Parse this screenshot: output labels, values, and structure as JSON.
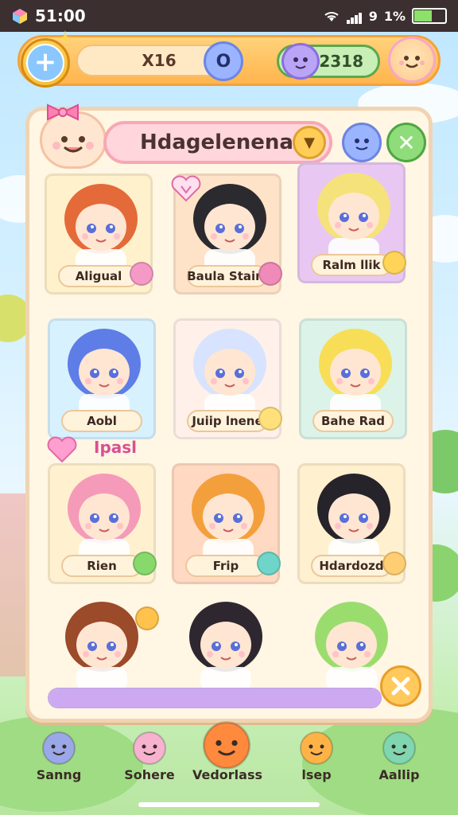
{
  "status_bar": {
    "time": "51:00",
    "signal_text": "9",
    "battery_percent_label": "1%",
    "battery_level": 0.55
  },
  "top_bar": {
    "coin_value": "X16",
    "o_button": "O",
    "gem_value": "2318"
  },
  "panel": {
    "title": "Hdagelenena",
    "favorites_label": "Ipasl"
  },
  "characters": [
    {
      "name": "Aligual",
      "hair": "#e46a3a",
      "bg": "#fff1cc",
      "badge_color": "#f59ac7"
    },
    {
      "name": "Baula Staim",
      "hair": "#2b2a2f",
      "bg": "#ffe3c9",
      "badge_color": "#f08ab8"
    },
    {
      "name": "Ralm llik",
      "hair": "#f5e27a",
      "bg": "#e8c8f2",
      "badge_color": "#ffd458"
    },
    {
      "name": "Aobl",
      "hair": "#5f7de6",
      "bg": "#d7f1ff",
      "badge_color": ""
    },
    {
      "name": "Juiip lnene",
      "hair": "#d7e3ff",
      "bg": "#fff0ea",
      "badge_color": "#ffe07a"
    },
    {
      "name": "Bahe Rad",
      "hair": "#f7de56",
      "bg": "#dcf3e9",
      "badge_color": ""
    },
    {
      "name": "Rien",
      "hair": "#f59ab8",
      "bg": "#fff1cf",
      "badge_color": "#88d96c"
    },
    {
      "name": "Frip",
      "hair": "#f3a03c",
      "bg": "#ffd9c2",
      "badge_color": "#6fd5c8"
    },
    {
      "name": "Hdardozd",
      "hair": "#26232a",
      "bg": "#fff0cf",
      "badge_color": "#ffce72"
    },
    {
      "name": "",
      "hair": "#9b4a2a",
      "bg": "#fff6e4",
      "badge_color": "#ffc24d"
    },
    {
      "name": "",
      "hair": "#2f2730",
      "bg": "#fff6e4",
      "badge_color": ""
    },
    {
      "name": "",
      "hair": "#9bdc6f",
      "bg": "#fff6e4",
      "badge_color": ""
    }
  ],
  "progress": {
    "value": 1.0
  },
  "bottom_nav": [
    {
      "label": "Sanng",
      "icon": "house-icon"
    },
    {
      "label": "Sohere",
      "icon": "mail-icon"
    },
    {
      "label": "Vedorlass",
      "icon": "orange-face-icon"
    },
    {
      "label": "lsep",
      "icon": "cat-face-icon"
    },
    {
      "label": "Aallip",
      "icon": "green-face-icon"
    }
  ],
  "colors": {
    "accent_orange": "#ffb54e",
    "panel_bg": "#fff6e4",
    "title_pink": "#ffd6dc",
    "progress_purple": "#cda9f2"
  }
}
